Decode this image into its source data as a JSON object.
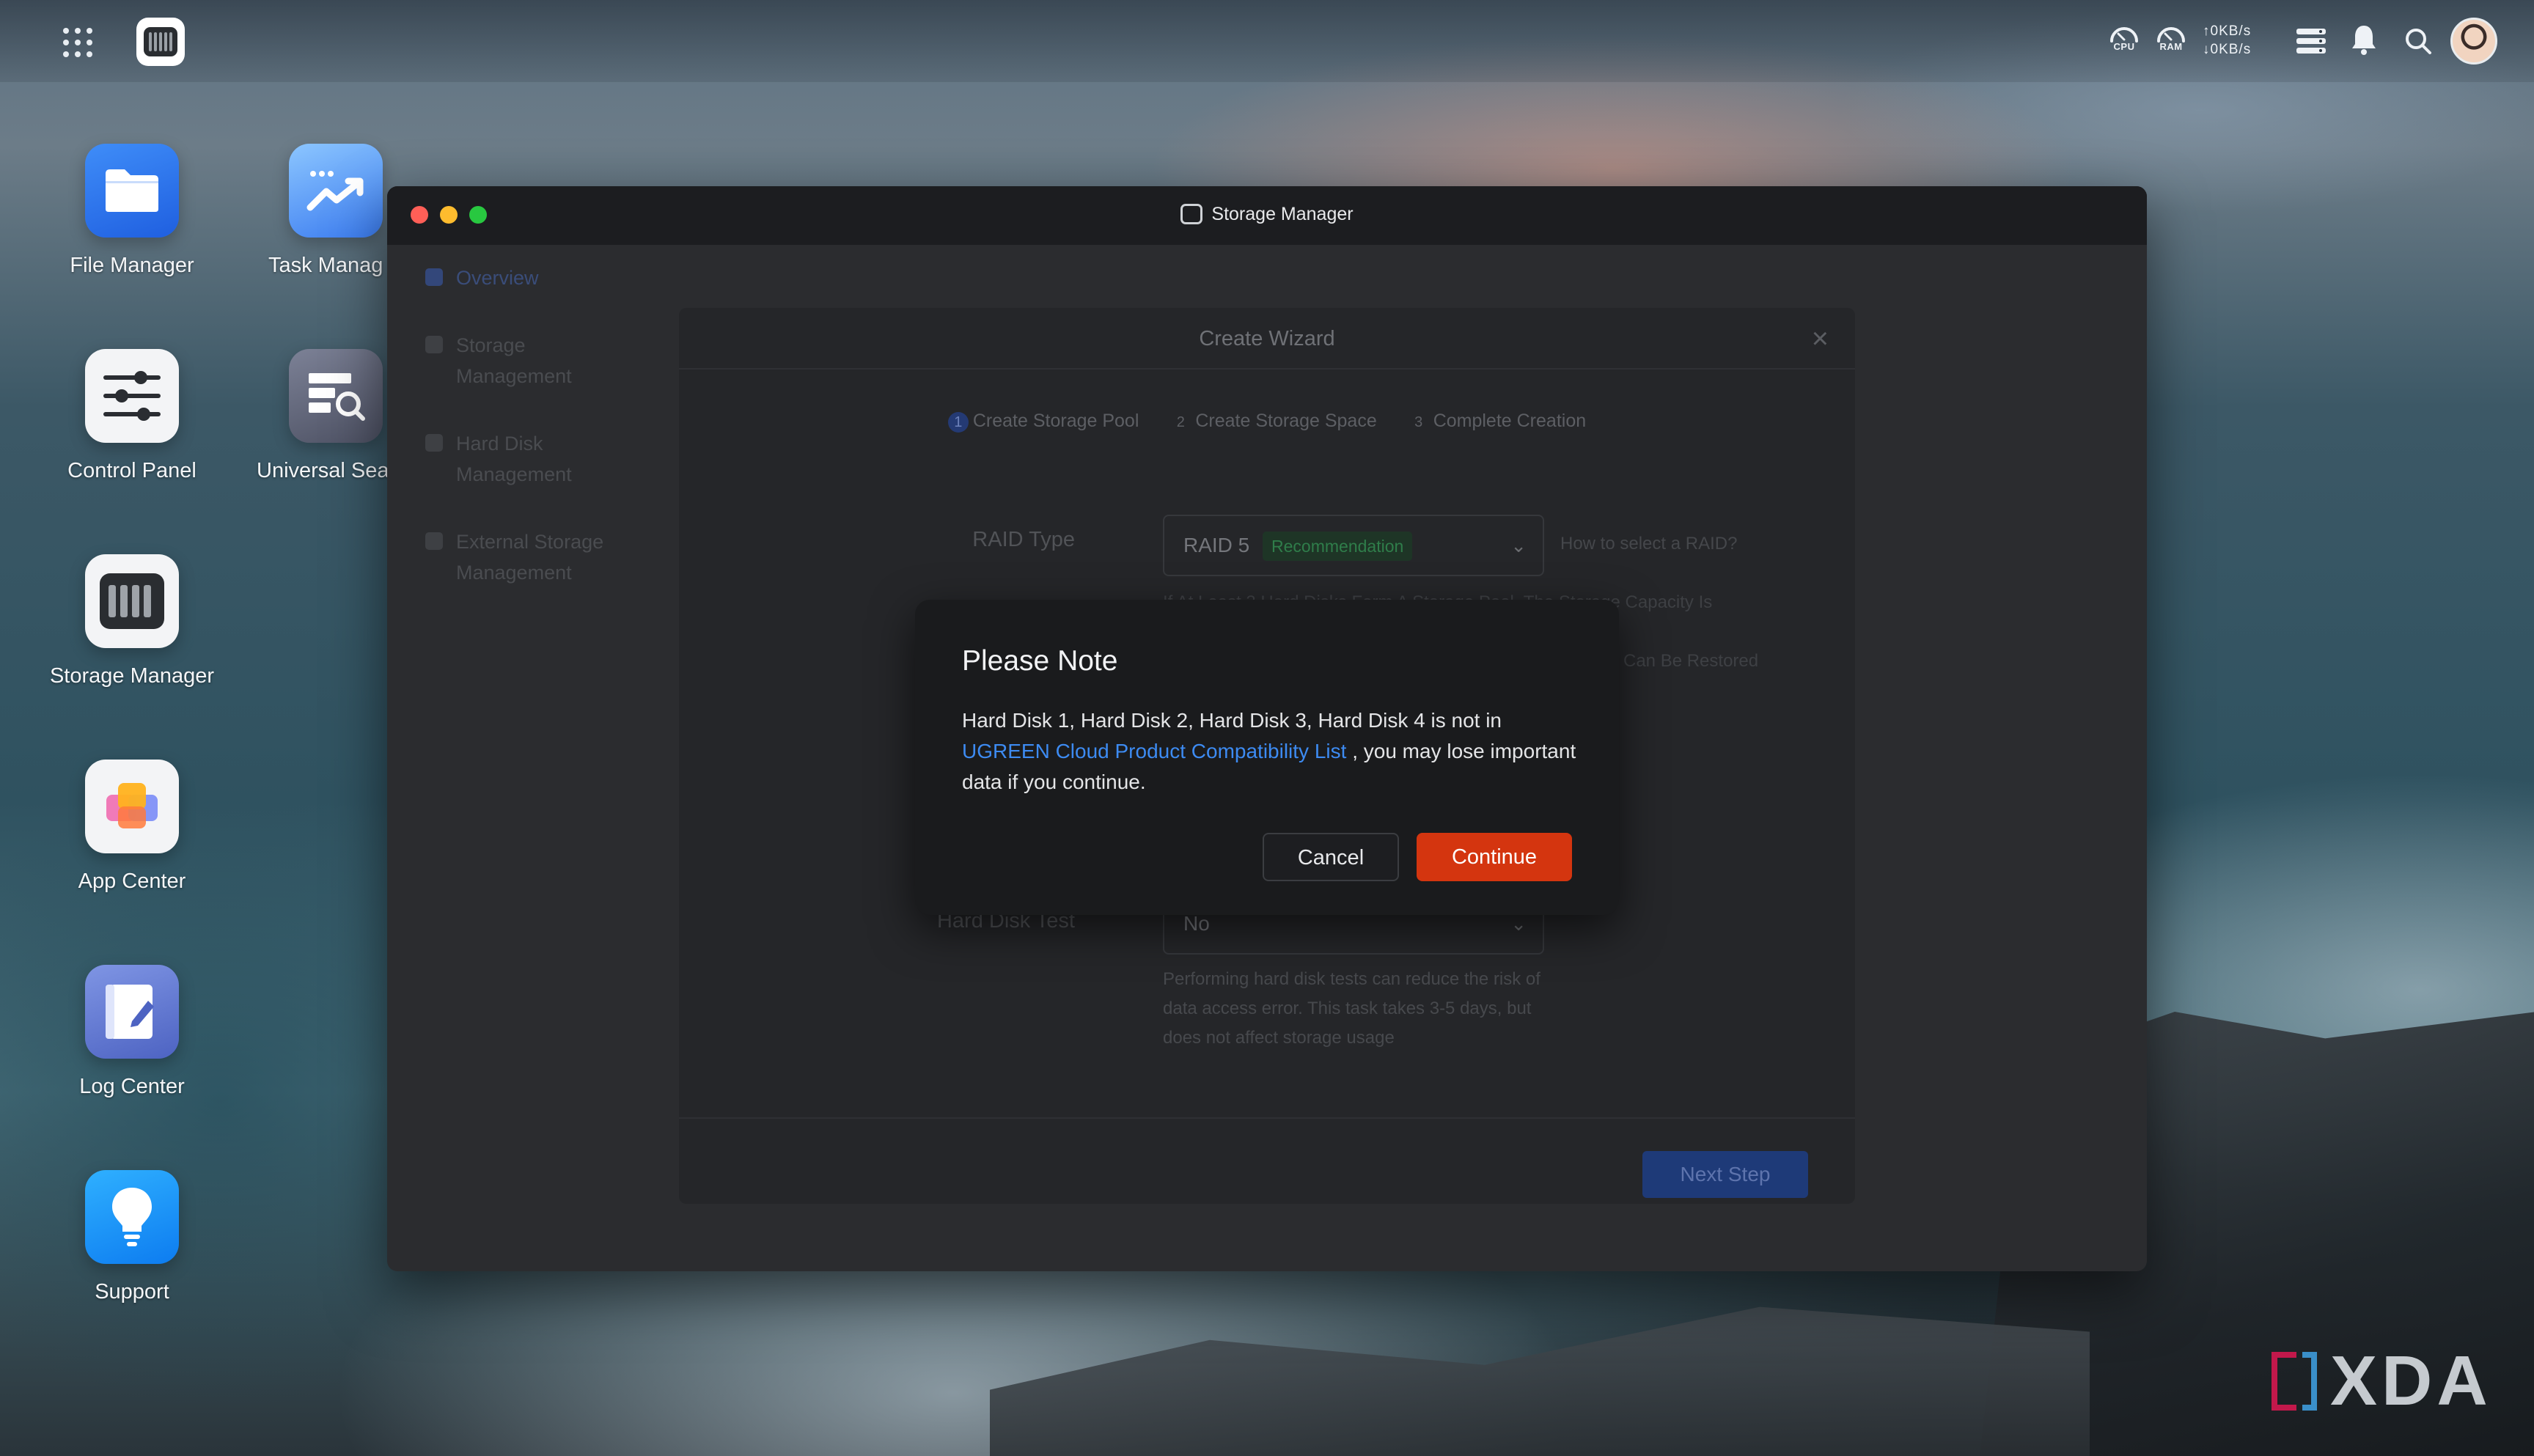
{
  "topbar": {
    "cpu_label": "CPU",
    "ram_label": "RAM",
    "upload_speed": "↑0KB/s",
    "download_speed": "↓0KB/s"
  },
  "desktop": {
    "icons": [
      {
        "label": "File Manager"
      },
      {
        "label": "Task Manag"
      },
      {
        "label": "Control Panel"
      },
      {
        "label": "Universal Sea"
      },
      {
        "label": "Storage Manager"
      },
      {
        "label": "App Center"
      },
      {
        "label": "Log Center"
      },
      {
        "label": "Support"
      }
    ]
  },
  "window": {
    "title": "Storage Manager",
    "sidebar": [
      {
        "label": "Overview"
      },
      {
        "label": "Storage Management"
      },
      {
        "label": "Hard Disk Management"
      },
      {
        "label": "External Storage Management"
      }
    ]
  },
  "wizard": {
    "title": "Create Wizard",
    "steps": [
      {
        "num": "1",
        "label": "Create Storage Pool"
      },
      {
        "num": "2",
        "label": "Create Storage Space"
      },
      {
        "num": "3",
        "label": "Complete Creation"
      }
    ],
    "raid_label": "RAID Type",
    "raid_value": "RAID 5",
    "raid_badge": "Recommendation",
    "raid_help": "How to select a RAID?",
    "info_line1": "If At Least 3 Hard Disks Form A Storage Pool, The Storage Capacity Is",
    "info_line2": "Can Be Restored",
    "disk_test_label": "Hard Disk Test",
    "disk_test_value": "No",
    "disk_test_desc": "Performing hard disk tests can reduce the risk of data access error. This task takes 3-5 days, but does not affect storage usage",
    "next_button": "Next Step"
  },
  "dialog": {
    "title": "Please Note",
    "text_before": "Hard Disk 1, Hard Disk 2, Hard Disk 3, Hard Disk 4 is not in",
    "link": "UGREEN Cloud Product Compatibility List",
    "text_after": ", you may lose important data if you continue.",
    "cancel": "Cancel",
    "continue": "Continue"
  },
  "watermark": {
    "text": "XDA"
  },
  "colors": {
    "accent_red": "#d4350f",
    "link_blue": "#3d8bf2",
    "primary_blue": "#1e3a78"
  }
}
